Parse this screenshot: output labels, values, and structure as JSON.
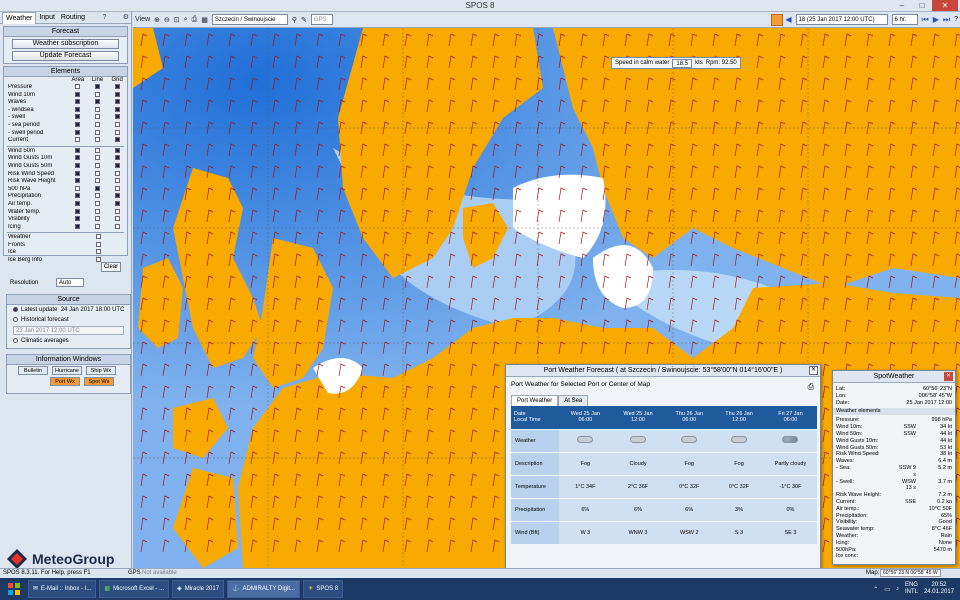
{
  "window": {
    "title": "SPOS 8"
  },
  "left": {
    "tabs": [
      "Weather",
      "Input",
      "Routing"
    ],
    "forecast": {
      "title": "Forecast",
      "btn1": "Weather subscription",
      "btn2": "Update Forecast"
    },
    "elements": {
      "title": "Elements",
      "cols": [
        "Area",
        "Line",
        "Grid"
      ],
      "rows": [
        {
          "l": "Pressure",
          "a": 0,
          "b": 1,
          "c": 1
        },
        {
          "l": "Wind 10m",
          "a": 1,
          "b": 0,
          "c": 1
        },
        {
          "l": "Waves",
          "a": 1,
          "b": 1,
          "c": 1
        },
        {
          "l": "- windsea",
          "a": 1,
          "b": 0,
          "c": 1
        },
        {
          "l": "- swell",
          "a": 1,
          "b": 0,
          "c": 1
        },
        {
          "l": "- sea period",
          "a": 1,
          "b": 0,
          "c": 0
        },
        {
          "l": "- swell period",
          "a": 1,
          "b": 0,
          "c": 0
        },
        {
          "l": "Current",
          "a": 0,
          "b": 0,
          "c": 1
        },
        {
          "l": "Wind 50m",
          "a": 1,
          "b": 0,
          "c": 1
        },
        {
          "l": "Wind Gusts 10m",
          "a": 1,
          "b": 0,
          "c": 1
        },
        {
          "l": "Wind Gusts 50m",
          "a": 1,
          "b": 0,
          "c": 1
        },
        {
          "l": "Risk Wind Speed",
          "a": 1,
          "b": 0,
          "c": 0
        },
        {
          "l": "Risk Wave Height",
          "a": 1,
          "b": 0,
          "c": 0
        },
        {
          "l": "500 hPa",
          "a": 0,
          "b": 1,
          "c": 0
        },
        {
          "l": "Precipitation",
          "a": 1,
          "b": 0,
          "c": 1
        },
        {
          "l": "Air temp.",
          "a": 1,
          "b": 0,
          "c": 1
        },
        {
          "l": "Water temp.",
          "a": 1,
          "b": 0,
          "c": 0
        },
        {
          "l": "Visibility",
          "a": 1,
          "b": 0,
          "c": 0
        },
        {
          "l": "Icing",
          "a": 1,
          "b": 0,
          "c": 0
        }
      ],
      "extra": [
        "Weather",
        "Fronts",
        "Ice",
        "Ice Berg Info"
      ],
      "clear": "Clear",
      "resolution_label": "Resolution",
      "resolution": "Auto"
    },
    "source": {
      "title": "Source",
      "latest": "Latest update",
      "latest_date": "24 Jan 2017 18:00 UTC",
      "historical": "Historical forecast",
      "hist_date": "23 Jan 2017 12:00 UTC",
      "climatic": "Climatic averages"
    },
    "info": {
      "title": "Information Windows",
      "b1": "Bulletin",
      "b2": "Hurricane",
      "b3": "Ship Wx",
      "b4": "Port Wx",
      "b5": "Spot Wx"
    },
    "logo": "MeteoGroup"
  },
  "toolbar": {
    "view": "View",
    "port": "Szczecin / Swinoujscie",
    "gps": "GPS",
    "time": "18 (25 Jan 2017 12:00 UTC)",
    "step": "6 hr."
  },
  "map": {
    "speed_label": "Speed in calm water",
    "speed": "18.5",
    "speed_unit": "kts",
    "rpm": "Rpm: 92.50"
  },
  "port": {
    "title": "Port Weather Forecast ( at Szczecin / Swinoujscie: 53°58'00\"N 014°16'00\"E )",
    "subtitle": "Port Weather for Selected Port or Center of Map",
    "tabs": [
      "Port Weather",
      "At Sea"
    ],
    "head": [
      "Date\nLocal Time",
      "Wed 25 Jan\n06:00",
      "Wed 25 Jan\n12:00",
      "Thu 26 Jan\n06:00",
      "Thu 26 Jan\n12:00",
      "Fri 27 Jan\n06:00"
    ],
    "rows": [
      {
        "l": "Weather",
        "c": [
          "",
          "",
          "",
          "",
          ""
        ]
      },
      {
        "l": "Description",
        "c": [
          "Fog",
          "Cloudy",
          "Fog",
          "Fog",
          "Partly cloudy"
        ]
      },
      {
        "l": "Temperature",
        "c": [
          "1°C 34F",
          "2°C 36F",
          "0°C 32F",
          "0°C 32F",
          "-1°C 30F"
        ]
      },
      {
        "l": "Precipitation",
        "c": [
          "6%",
          "6%",
          "6%",
          "3%",
          "0%"
        ]
      },
      {
        "l": "Wind (Bft)",
        "c": [
          "W 3",
          "WNW 3",
          "WSW 2",
          "S 3",
          "SE 3"
        ]
      }
    ]
  },
  "spot": {
    "title": "SpotWeather",
    "lat_l": "Lat:",
    "lat": "60°56' 23\"N",
    "lon_l": "Lon:",
    "lon": "006°58' 45\"W",
    "date_l": "Date:",
    "date": "25 Jan 2017 12:00",
    "el": "Weather elements",
    "rows": [
      {
        "k": "Pressure:",
        "m": "",
        "v": "998 hPa"
      },
      {
        "k": "Wind 10m:",
        "m": "SSW",
        "v": "34 kt"
      },
      {
        "k": "Wind 50m:",
        "m": "SSW",
        "v": "44 kt"
      },
      {
        "k": "Wind Gusts 10m:",
        "m": "",
        "v": "44 kt"
      },
      {
        "k": "Wind Gusts 50m:",
        "m": "",
        "v": "53 kt"
      },
      {
        "k": "Risk Wind Speed:",
        "m": "",
        "v": "38 kt"
      },
      {
        "k": "Waves:",
        "m": "",
        "v": "6.4 m"
      },
      {
        "k": "- Sea:",
        "m": "SSW 9 s",
        "v": "5.2 m"
      },
      {
        "k": "- Swell:",
        "m": "WSW 13 s",
        "v": "3.7 m"
      },
      {
        "k": "Risk Wave Height:",
        "m": "",
        "v": "7.2 m"
      },
      {
        "k": "Current:",
        "m": "SSE",
        "v": "0.2 kn"
      },
      {
        "k": "Air temp.:",
        "m": "",
        "v": "10°C 50F"
      },
      {
        "k": "Precipitation:",
        "m": "",
        "v": "65%"
      },
      {
        "k": "Visibility:",
        "m": "",
        "v": "Good"
      },
      {
        "k": "Seawater temp:",
        "m": "",
        "v": "8°C 46F"
      },
      {
        "k": "Weather:",
        "m": "",
        "v": "Rain"
      },
      {
        "k": "Icing:",
        "m": "",
        "v": "None"
      },
      {
        "k": "500hPa:",
        "m": "",
        "v": "5470 m"
      },
      {
        "k": "Ice conc:",
        "m": "",
        "v": ""
      }
    ]
  },
  "status": {
    "left": "SPOS 8.3.11. For Help, press F1",
    "gps": "GPS",
    "gps_val": "Not available",
    "map": "Map:",
    "map_coord": "60°56' 23 N  06°58' 45 W"
  },
  "taskbar": {
    "items": [
      "E-Mail :: Inbox - I...",
      "Microsoft Excel - ...",
      "Miracle 2017",
      "ADMIRALTY Digit...",
      "SPOS 8"
    ],
    "lang": "ENG",
    "kb": "INTL",
    "time": "20:52",
    "date": "24.01.2017"
  }
}
